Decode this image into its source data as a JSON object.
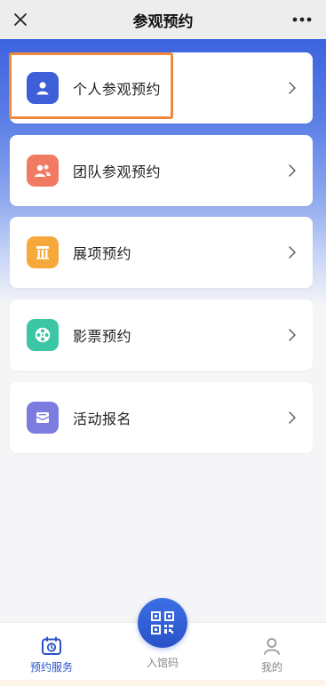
{
  "header": {
    "title": "参观预约",
    "close_icon": "close-icon",
    "more_icon": "more-icon"
  },
  "colors": {
    "brand": "#2a52c9",
    "highlight": "#f08a3a",
    "tab_active": "#2a52c9",
    "tab_inactive": "#888888"
  },
  "menu": [
    {
      "label": "个人参观预约",
      "icon": "person-icon",
      "color": "#3d5fd8"
    },
    {
      "label": "团队参观预约",
      "icon": "group-icon",
      "color": "#f07a62"
    },
    {
      "label": "展项预约",
      "icon": "exhibit-icon",
      "color": "#f6a93b"
    },
    {
      "label": "影票预约",
      "icon": "film-icon",
      "color": "#3cc6a4"
    },
    {
      "label": "活动报名",
      "icon": "envelope-icon",
      "color": "#7c7be0"
    }
  ],
  "tabbar": {
    "tabs": [
      {
        "label": "预约服务",
        "icon": "calendar-clock-icon"
      },
      {
        "label": "入馆码",
        "icon": "qrcode-icon"
      },
      {
        "label": "我的",
        "icon": "user-icon"
      }
    ]
  }
}
